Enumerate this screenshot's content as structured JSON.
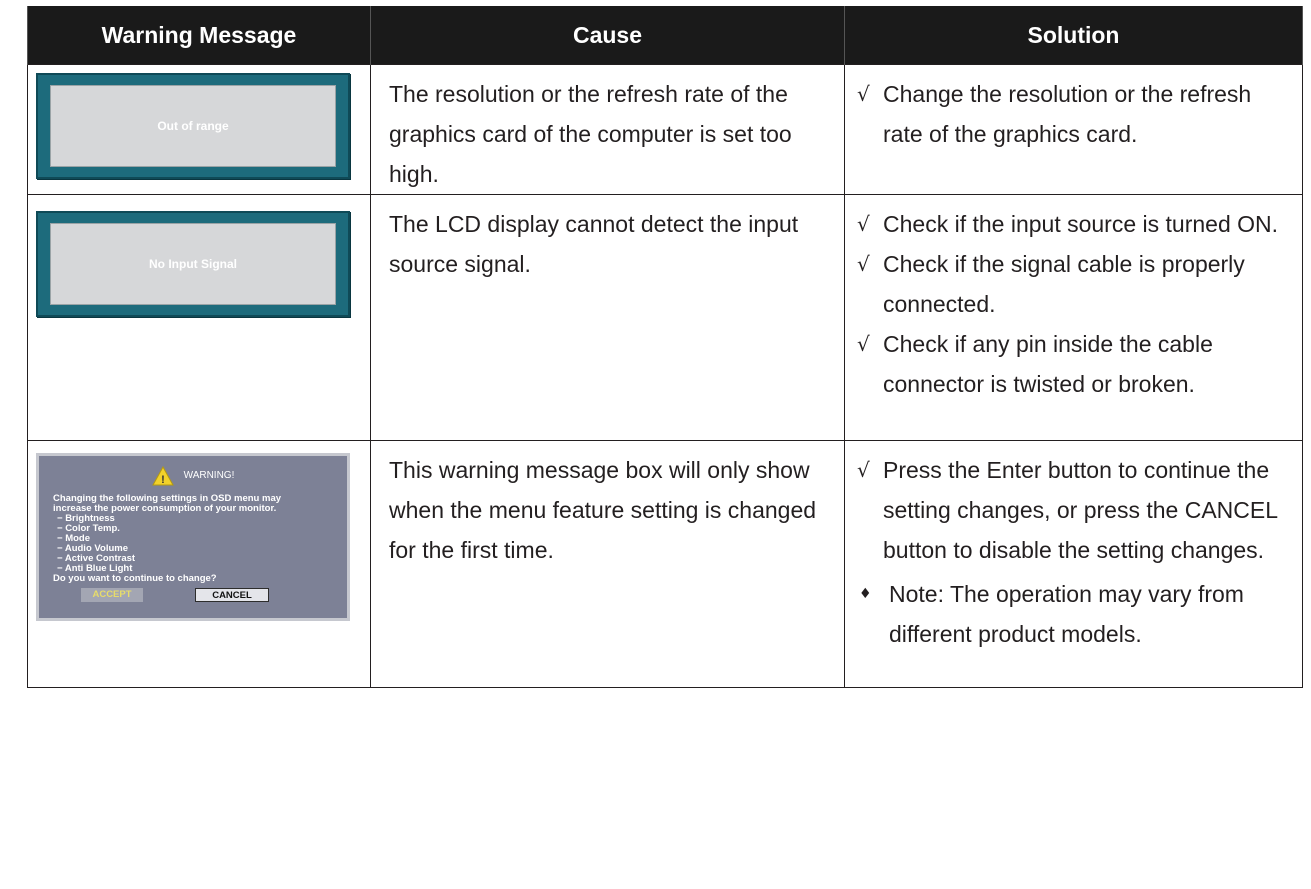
{
  "headers": [
    "Warning Message",
    "Cause",
    "Solution"
  ],
  "rows": [
    {
      "osd_message": "Out of range",
      "cause": "The resolution or the refresh rate of the graphics card of the computer is set too high.",
      "solutions": [
        {
          "mark": "√",
          "text": "Change the resolution or the refresh rate of the graphics card."
        }
      ]
    },
    {
      "osd_message": "No Input Signal",
      "cause": "The LCD display cannot detect the input source signal.",
      "solutions": [
        {
          "mark": "√",
          "text": "Check if the input source is turned ON."
        },
        {
          "mark": "√",
          "text": "Check if the signal cable is properly connected."
        },
        {
          "mark": "√",
          "text": "Check if any pin inside the cable connector is twisted or broken."
        }
      ]
    },
    {
      "osd_warning": {
        "title": "WARNING!",
        "intro": [
          "Changing the  following settings in OSD menu may",
          "increase the power consumption of your monitor."
        ],
        "items": [
          "Brightness",
          "Color Temp.",
          "Mode",
          "Audio Volume",
          "Active Contrast",
          "Anti Blue Light"
        ],
        "question": "Do you want to continue to change?",
        "accept_label": "ACCEPT",
        "cancel_label": "CANCEL"
      },
      "cause": "This warning message box will only show when the menu feature setting is changed for the first time.",
      "solutions": [
        {
          "mark": "√",
          "text": "Press the Enter button to continue the setting changes, or press the CANCEL button to disable the setting changes."
        },
        {
          "mark": "♦",
          "text": "Note: The operation may vary from different product models."
        }
      ]
    }
  ],
  "colors": {
    "header_bg": "#1a1a1a",
    "osd_teal": "#1d6b7c",
    "osd_screen": "#d6d7d9",
    "warning_bg": "#7d8196",
    "warning_icon": "#f2d22b"
  }
}
